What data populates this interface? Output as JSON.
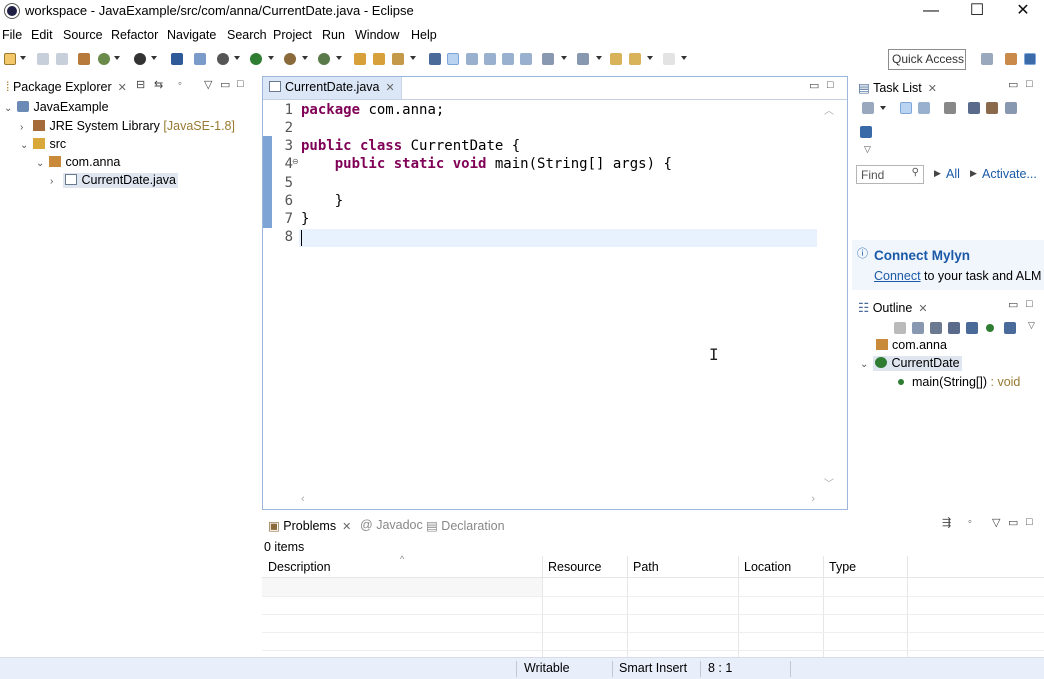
{
  "window": {
    "title": "workspace - JavaExample/src/com/anna/CurrentDate.java - Eclipse",
    "minimize": "—",
    "maximize": "☐",
    "close": "✕"
  },
  "menu": [
    "File",
    "Edit",
    "Source",
    "Refactor",
    "Navigate",
    "Search",
    "Project",
    "Run",
    "Window",
    "Help"
  ],
  "toolbar": {
    "quick_access_placeholder": "Quick Access"
  },
  "package_explorer": {
    "tab_label": "Package Explorer",
    "tree": {
      "project": "JavaExample",
      "jre_label": "JRE System Library",
      "jre_version": "[JavaSE-1.8]",
      "src": "src",
      "package": "com.anna",
      "file": "CurrentDate.java"
    }
  },
  "editor": {
    "tab_label": "CurrentDate.java",
    "line_numbers": [
      "1",
      "2",
      "3",
      "4",
      "5",
      "6",
      "7",
      "8"
    ],
    "lines": {
      "l1_kw": "package",
      "l1_rest": " com.anna;",
      "l3_kw": "public class",
      "l3_rest": " CurrentDate {",
      "l4_indent": "    ",
      "l4_kw": "public static void",
      "l4_rest": " main(String[] args) {",
      "l6": "    }",
      "l7": "}"
    },
    "cursor_line": 8
  },
  "task_list": {
    "tab_label": "Task List",
    "find_placeholder": "Find",
    "all_label": "All",
    "activate_label": "Activate...",
    "connect_title": "Connect Mylyn",
    "connect_link": "Connect",
    "connect_text": " to your task and ALM"
  },
  "outline": {
    "tab_label": "Outline",
    "package": "com.anna",
    "class": "CurrentDate",
    "method": "main(String[])",
    "method_type": " : void"
  },
  "problems": {
    "tab_problems": "Problems",
    "tab_javadoc": "Javadoc",
    "tab_declaration": "Declaration",
    "count": "0 items",
    "columns": [
      "Description",
      "Resource",
      "Path",
      "Location",
      "Type"
    ]
  },
  "status": {
    "writable": "Writable",
    "insert_mode": "Smart Insert",
    "position": "8 : 1"
  },
  "colors": {
    "keyword": "#7f0055",
    "link": "#1a5aa6",
    "current_line": "#e8f2fe",
    "status_bar": "#e8eefa"
  }
}
